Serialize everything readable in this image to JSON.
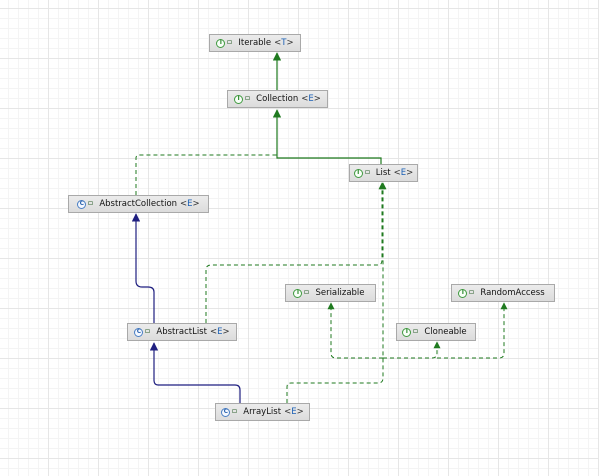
{
  "diagram": {
    "nodes": {
      "iterable": {
        "kind": "interface",
        "kind_letter": "I",
        "name": "Iterable",
        "type_param": "T"
      },
      "collection": {
        "kind": "interface",
        "kind_letter": "I",
        "name": "Collection",
        "type_param": "E"
      },
      "list": {
        "kind": "interface",
        "kind_letter": "I",
        "name": "List",
        "type_param": "E"
      },
      "abstract_collection": {
        "kind": "abstract-class",
        "kind_letter": "C",
        "name": "AbstractCollection",
        "type_param": "E"
      },
      "serializable": {
        "kind": "interface",
        "kind_letter": "I",
        "name": "Serializable",
        "type_param": ""
      },
      "random_access": {
        "kind": "interface",
        "kind_letter": "I",
        "name": "RandomAccess",
        "type_param": ""
      },
      "cloneable": {
        "kind": "interface",
        "kind_letter": "I",
        "name": "Cloneable",
        "type_param": ""
      },
      "abstract_list": {
        "kind": "abstract-class",
        "kind_letter": "C",
        "name": "AbstractList",
        "type_param": "E"
      },
      "array_list": {
        "kind": "class",
        "kind_letter": "C",
        "name": "ArrayList",
        "type_param": "E"
      }
    },
    "edges": [
      {
        "from": "collection",
        "to": "iterable",
        "type": "extends-interface"
      },
      {
        "from": "list",
        "to": "collection",
        "type": "extends-interface"
      },
      {
        "from": "abstract_collection",
        "to": "collection",
        "type": "implements"
      },
      {
        "from": "abstract_list",
        "to": "abstract_collection",
        "type": "extends-class"
      },
      {
        "from": "abstract_list",
        "to": "list",
        "type": "implements"
      },
      {
        "from": "array_list",
        "to": "abstract_list",
        "type": "extends-class"
      },
      {
        "from": "array_list",
        "to": "list",
        "type": "implements"
      },
      {
        "from": "array_list",
        "to": "serializable",
        "type": "implements"
      },
      {
        "from": "array_list",
        "to": "cloneable",
        "type": "implements"
      },
      {
        "from": "array_list",
        "to": "random_access",
        "type": "implements"
      }
    ],
    "colors": {
      "interface_edge": "#1f7a1f",
      "class_edge": "#1f1f80",
      "node_border": "#a9a9a9",
      "interface_icon": "#3f9a3f",
      "class_icon": "#4a7fc4",
      "type_param": "#1a5fb4"
    }
  }
}
